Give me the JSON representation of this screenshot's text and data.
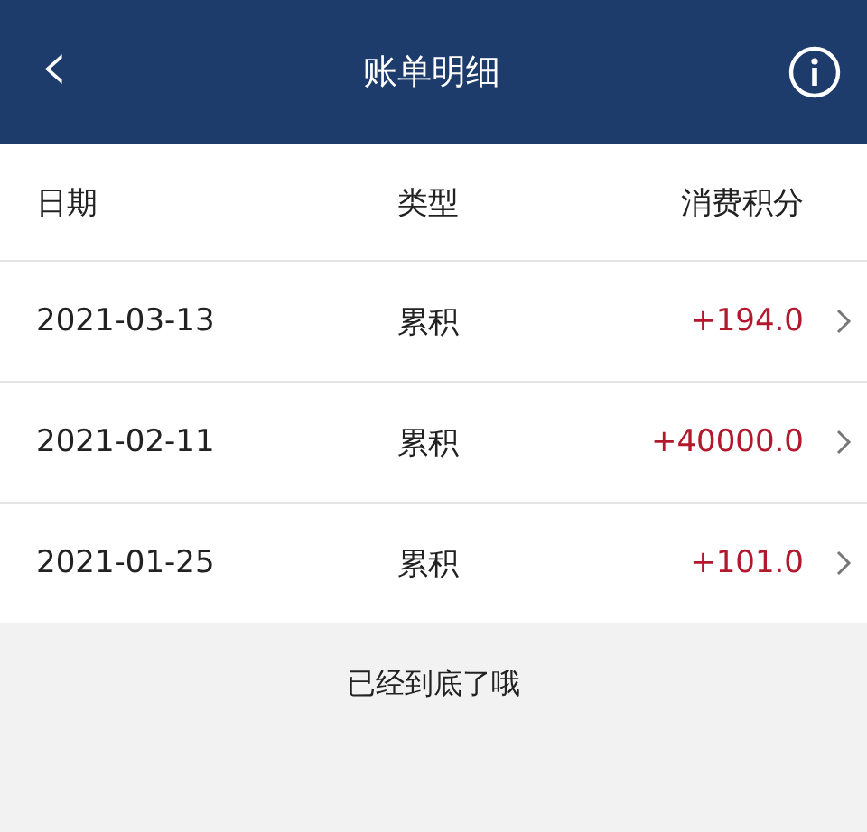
{
  "header": {
    "back": "‹",
    "title": "账单明细"
  },
  "table": {
    "columns": [
      "日期",
      "类型",
      "消费积分"
    ],
    "rows": [
      {
        "date": "2021-03-13",
        "type": "累积",
        "points": "+194.0"
      },
      {
        "date": "2021-02-11",
        "type": "累积",
        "points": "+40000.0"
      },
      {
        "date": "2021-01-25",
        "type": "累积",
        "points": "+101.0"
      }
    ]
  },
  "footer_note": "已经到底了哦"
}
